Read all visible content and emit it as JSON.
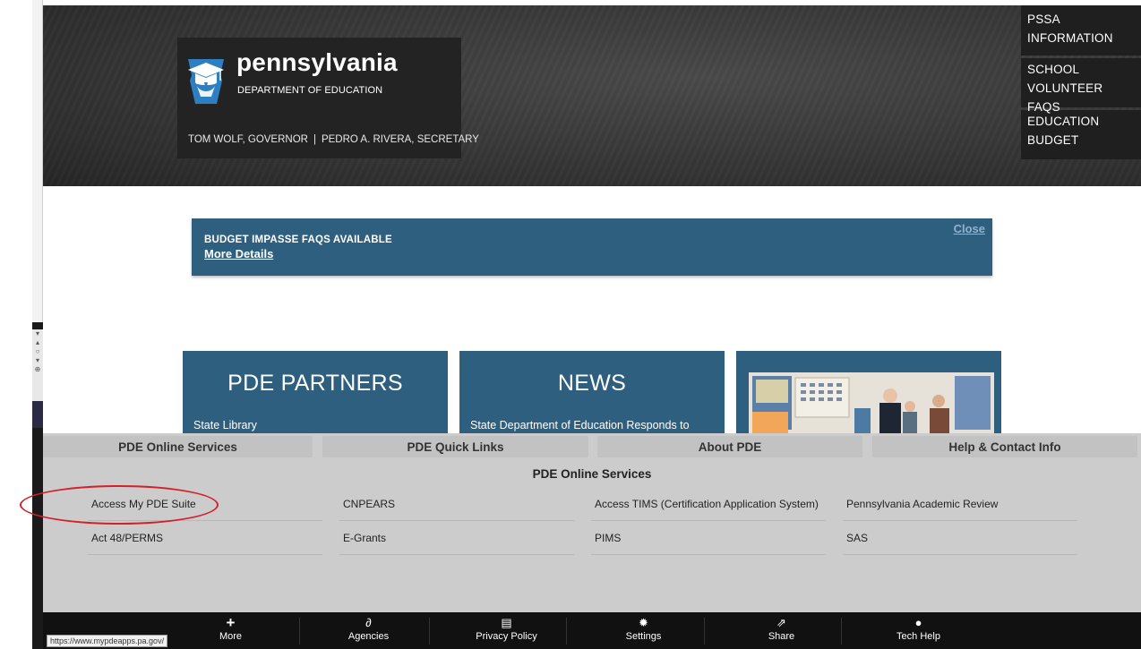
{
  "header": {
    "brand_name": "pennsylvania",
    "brand_sub": "DEPARTMENT OF EDUCATION",
    "governor": "TOM WOLF, GOVERNOR",
    "separator": "|",
    "secretary": "PEDRO A. RIVERA, SECRETARY"
  },
  "top_nav": [
    {
      "label": "PSSA INFORMATION"
    },
    {
      "label": "SCHOOL VOLUNTEER FAQS"
    },
    {
      "label": "EDUCATION BUDGET"
    }
  ],
  "alert": {
    "title": "BUDGET IMPASSE FAQS AVAILABLE",
    "link": "More Details",
    "close": "Close"
  },
  "tiles": {
    "partners": {
      "title": "PDE PARTNERS",
      "text": "State Library"
    },
    "news": {
      "title": "NEWS",
      "text": "State Department of Education Responds to"
    }
  },
  "footer": {
    "tabs": [
      "PDE Online Services",
      "PDE Quick Links",
      "About PDE",
      "Help & Contact Info"
    ],
    "section_heading": "PDE Online Services",
    "links": [
      [
        "Access My PDE Suite",
        "CNPEARS",
        "Access TIMS (Certification Application System)",
        "Pennsylvania Academic Review"
      ],
      [
        "Act 48/PERMS",
        "E-Grants",
        "PIMS",
        "SAS"
      ]
    ]
  },
  "toolbar": {
    "items": [
      {
        "label": "More",
        "icon": "plus-icon"
      },
      {
        "label": "Agencies",
        "icon": "link-icon"
      },
      {
        "label": "Privacy Policy",
        "icon": "document-icon"
      },
      {
        "label": "Settings",
        "icon": "gear-icon"
      },
      {
        "label": "Share",
        "icon": "share-icon"
      },
      {
        "label": "Tech Help",
        "icon": "chat-icon"
      }
    ]
  },
  "status_bar": {
    "url": "https://www.mypdeapps.pa.gov/"
  },
  "colors": {
    "header_dark": "#2f2f2f",
    "brand_blue": "#2f5f7e",
    "footer_gray": "#cccccc",
    "toolbar_black": "#111111",
    "annotation_red": "#d2212a"
  }
}
